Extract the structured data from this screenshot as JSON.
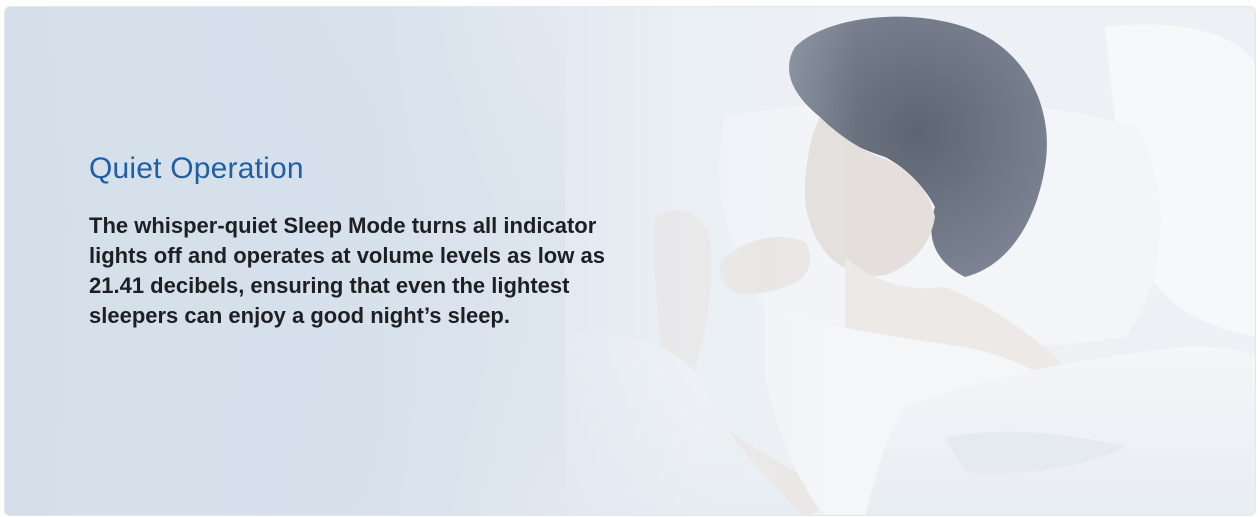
{
  "banner": {
    "title": "Quiet Operation",
    "description": "The whisper-quiet Sleep Mode turns all indicator lights off and operates at volume levels as low as 21.41 decibels, ensuring that even the lightest sleepers can enjoy a good night’s sleep.",
    "image_subject": "woman-sleeping-in-bed",
    "colors": {
      "title": "#1f5fa8",
      "body_text": "#1d1f24",
      "background": "#d6dfea"
    }
  }
}
